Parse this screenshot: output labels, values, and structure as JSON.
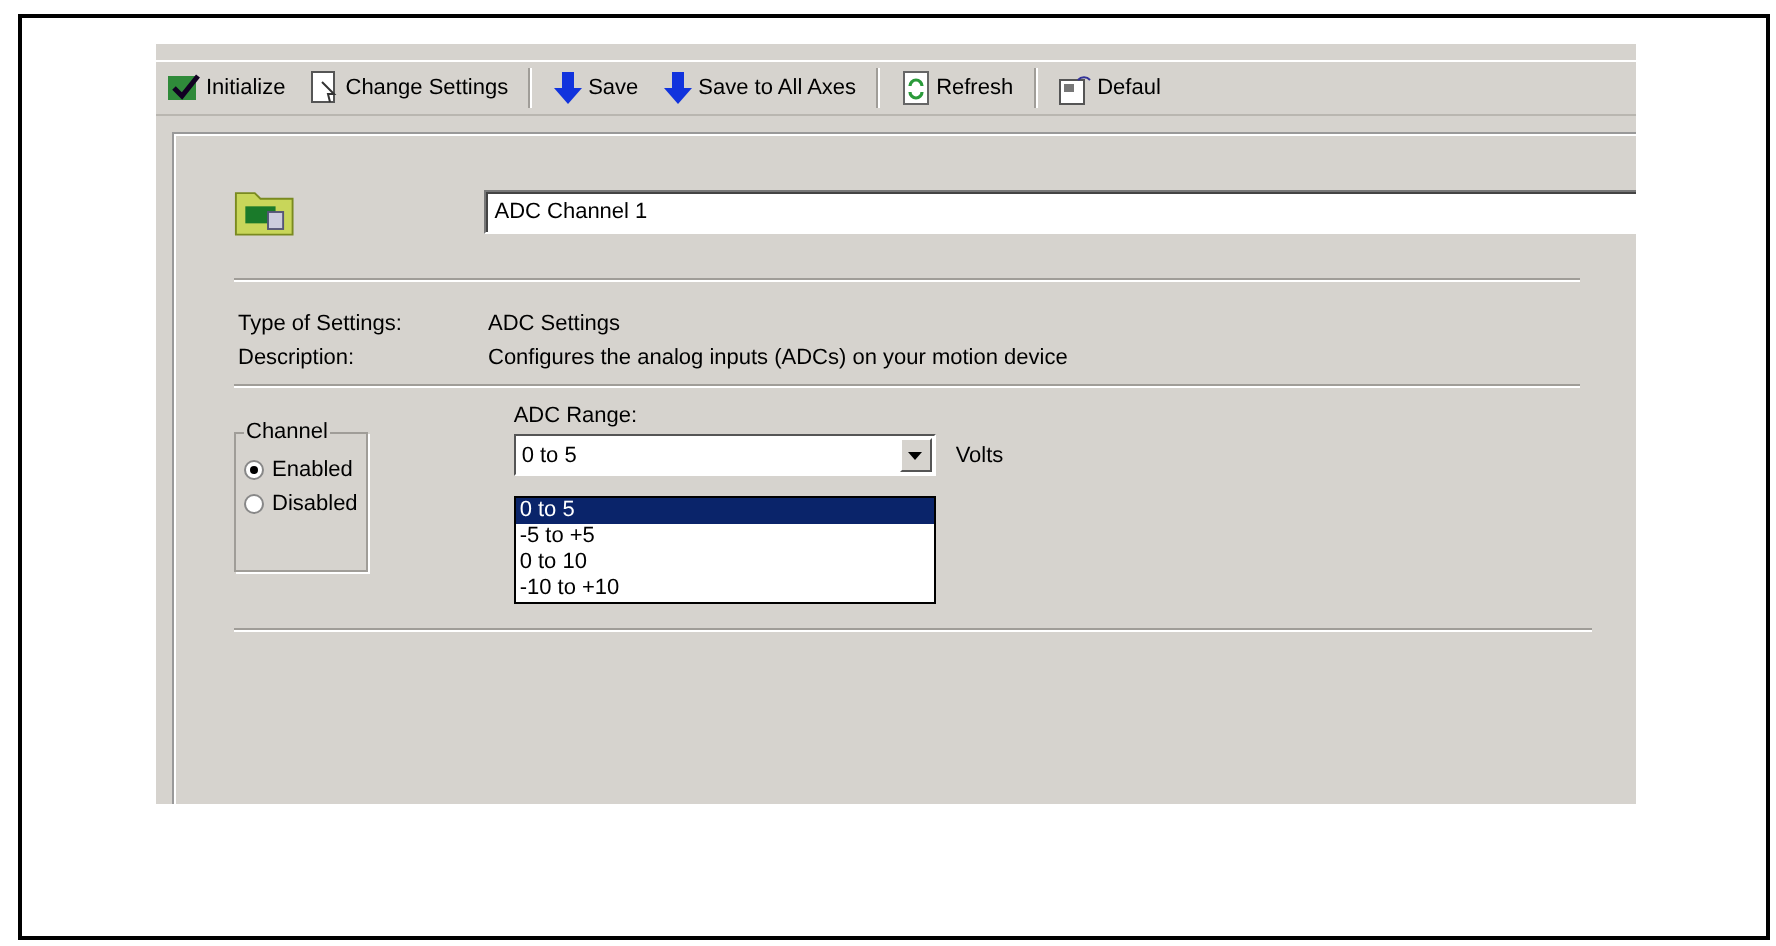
{
  "toolbar": {
    "buttons": [
      {
        "kind": "initialize",
        "label": "Initialize",
        "separator_after": false
      },
      {
        "kind": "settings",
        "label": "Change Settings",
        "separator_after": true
      },
      {
        "kind": "save",
        "label": "Save",
        "separator_after": false
      },
      {
        "kind": "save",
        "label": "Save to All Axes",
        "separator_after": true
      },
      {
        "kind": "refresh",
        "label": "Refresh",
        "separator_after": true
      },
      {
        "kind": "defaults",
        "label": "Defaul",
        "separator_after": false
      }
    ]
  },
  "name_field": {
    "value": "ADC Channel 1"
  },
  "info": [
    {
      "label": "Type of Settings:",
      "value": "ADC Settings"
    },
    {
      "label": "Description:",
      "value": "Configures the analog inputs (ADCs) on your motion device"
    }
  ],
  "channel": {
    "title": "Channel",
    "options": [
      {
        "label": "Enabled",
        "selected": true
      },
      {
        "label": "Disabled",
        "selected": false
      }
    ]
  },
  "adc_range": {
    "label": "ADC Range:",
    "value": "0 to 5",
    "unit": "Volts",
    "expanded": true,
    "options": [
      {
        "label": "0 to 5",
        "selected": true
      },
      {
        "label": "-5 to +5",
        "selected": false
      },
      {
        "label": "0 to 10",
        "selected": false
      },
      {
        "label": "-10 to +10",
        "selected": false
      }
    ]
  }
}
